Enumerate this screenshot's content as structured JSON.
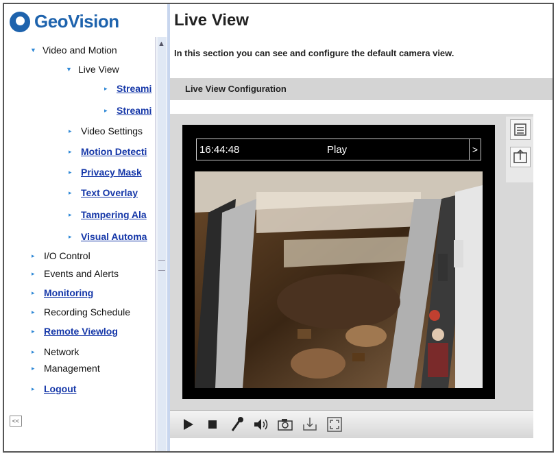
{
  "brand": {
    "name": "GeoVision"
  },
  "sidebar": {
    "items": [
      {
        "label": "Video and Motion",
        "level": 1,
        "expanded": true,
        "link": false
      },
      {
        "label": "Live View",
        "level": 2,
        "expanded": true,
        "link": false
      },
      {
        "label": "Streami",
        "level": 3,
        "link": true
      },
      {
        "label": "Streami",
        "level": 3,
        "link": true
      },
      {
        "label": "Video Settings",
        "level": 2,
        "link": false
      },
      {
        "label": "Motion Detecti",
        "level": 2,
        "link": true
      },
      {
        "label": "Privacy Mask",
        "level": 2,
        "link": true
      },
      {
        "label": "Text Overlay",
        "level": 2,
        "link": true
      },
      {
        "label": "Tampering Ala",
        "level": 2,
        "link": true
      },
      {
        "label": "Visual Automa",
        "level": 2,
        "link": true
      },
      {
        "label": "I/O Control",
        "level": 0,
        "link": false
      },
      {
        "label": "Events and Alerts",
        "level": 0,
        "link": false
      },
      {
        "label": "Monitoring",
        "level": 0,
        "link": true
      },
      {
        "label": "Recording Schedule",
        "level": 0,
        "link": false
      },
      {
        "label": "Remote Viewlog",
        "level": 0,
        "link": true
      },
      {
        "label": "Network",
        "level": 0,
        "link": false
      },
      {
        "label": "Management",
        "level": 0,
        "link": false
      },
      {
        "label": "Logout",
        "level": 0,
        "link": true
      }
    ],
    "collapse_label": "<<"
  },
  "main": {
    "title": "Live View",
    "description": "In this section you can see and configure the default camera view.",
    "section_title": "Live View Configuration"
  },
  "viewer": {
    "time": "16:44:48",
    "state": "Play",
    "next_label": ">"
  },
  "toolbar": {
    "buttons": [
      "play-icon",
      "stop-icon",
      "microphone-icon",
      "speaker-icon",
      "snapshot-icon",
      "save-icon",
      "fullscreen-icon"
    ]
  },
  "side_tools": [
    "settings-panel-icon",
    "export-icon"
  ]
}
